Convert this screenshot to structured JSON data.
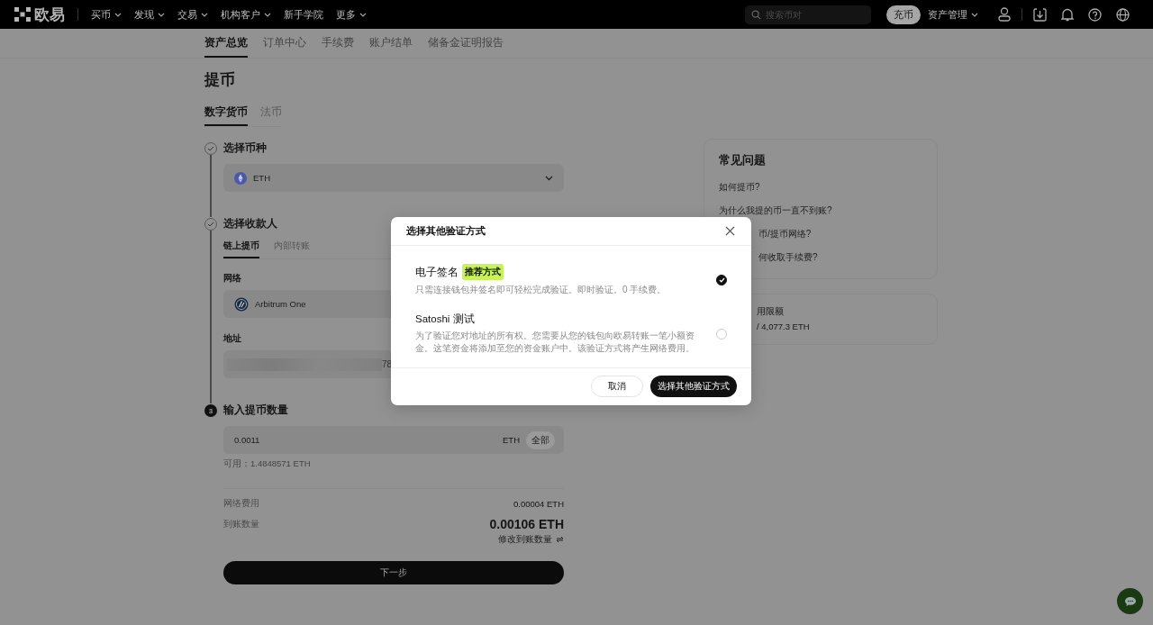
{
  "nav": {
    "logo": "欧易",
    "menu": [
      {
        "label": "买币",
        "dropdown": true
      },
      {
        "label": "发现",
        "dropdown": true
      },
      {
        "label": "交易",
        "dropdown": true
      },
      {
        "label": "机构客户",
        "dropdown": true
      },
      {
        "label": "新手学院",
        "dropdown": false
      },
      {
        "label": "更多",
        "dropdown": true
      }
    ],
    "search": {
      "placeholder": "搜索币对"
    },
    "deposit_button": "充币",
    "assets_menu": "资产管理"
  },
  "subnav": [
    {
      "label": "资产总览",
      "selected": true
    },
    {
      "label": "订单中心",
      "selected": false
    },
    {
      "label": "手续费",
      "selected": false
    },
    {
      "label": "账户结单",
      "selected": false
    },
    {
      "label": "储备金证明报告",
      "selected": false
    }
  ],
  "page_title": "提币",
  "type_tabs": [
    {
      "label": "数字货币",
      "selected": true
    },
    {
      "label": "法币",
      "selected": false
    }
  ],
  "step_coin": {
    "done": true,
    "title": "选择币种",
    "coin": "ETH"
  },
  "step_recipient": {
    "done": true,
    "title": "选择收款人",
    "tabs": [
      {
        "label": "链上提币",
        "selected": true
      },
      {
        "label": "内部转账",
        "selected": false
      }
    ],
    "network_label": "网络",
    "network": "Arbitrum One",
    "address_label": "地址",
    "address_visible": "78"
  },
  "step_amount": {
    "done": false,
    "number": "3",
    "title": "输入提币数量",
    "amount": "0.0011",
    "unit": "ETH",
    "max_button": "全部",
    "available": "可用：1.4848571 ETH",
    "fee_label": "网络费用",
    "fee": "0.00004 ETH",
    "receive_label": "到账数量",
    "receive": "0.00106 ETH",
    "edit_link": "修改到账数量"
  },
  "next_button": "下一步",
  "faq": {
    "title": "常见问题",
    "items": [
      {
        "text": "如何提币?",
        "cut": false
      },
      {
        "text": "为什么我提的币一直不到账?",
        "cut": false
      },
      {
        "text": "币/提币网络?",
        "cut": true
      },
      {
        "text": "何收取手续费?",
        "cut": true
      }
    ]
  },
  "limits": {
    "title": "用限额",
    "value": "/ 4,077.3 ETH",
    "cut": true
  },
  "modal": {
    "title": "选择其他验证方式",
    "options": [
      {
        "title": "电子签名",
        "badge": "推荐方式",
        "description": "只需连接钱包并签名即可轻松完成验证。即时验证。0 手续费。",
        "selected": true
      },
      {
        "title": "Satoshi 测试",
        "description": "为了验证您对地址的所有权。您需要从您的钱包向欧易转账一笔小额资金。这笔资金将添加至您的资金账户中。该验证方式将产生网络费用。",
        "selected": false
      }
    ],
    "cancel": "取消",
    "confirm": "选择其他验证方式"
  }
}
